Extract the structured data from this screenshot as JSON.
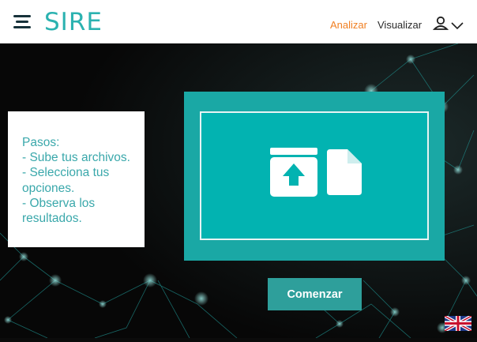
{
  "header": {
    "logo": "SIRE",
    "nav": {
      "analizar": "Analizar",
      "visualizar": "Visualizar"
    },
    "menu_icon": "hamburger-menu-icon",
    "user_icon": "user-icon",
    "dropdown_icon": "chevron-down-icon"
  },
  "steps": {
    "lines": [
      "Pasos:",
      "- Sube tus archivos.",
      "- Selecciona tus",
      "opciones.",
      "- Observa los",
      "resultados."
    ]
  },
  "dropzone": {
    "icons": [
      "upload-box-icon",
      "file-icon"
    ]
  },
  "start_button": "Comenzar",
  "language_flag": "uk-flag-icon",
  "colors": {
    "accent": "#2bb2b0",
    "nav_active": "#f07f22",
    "dropzone_outer": "#1aa8a5",
    "dropzone_inner": "#02b3b1",
    "button": "#2e9f9b",
    "background": "#0b0b0b"
  }
}
